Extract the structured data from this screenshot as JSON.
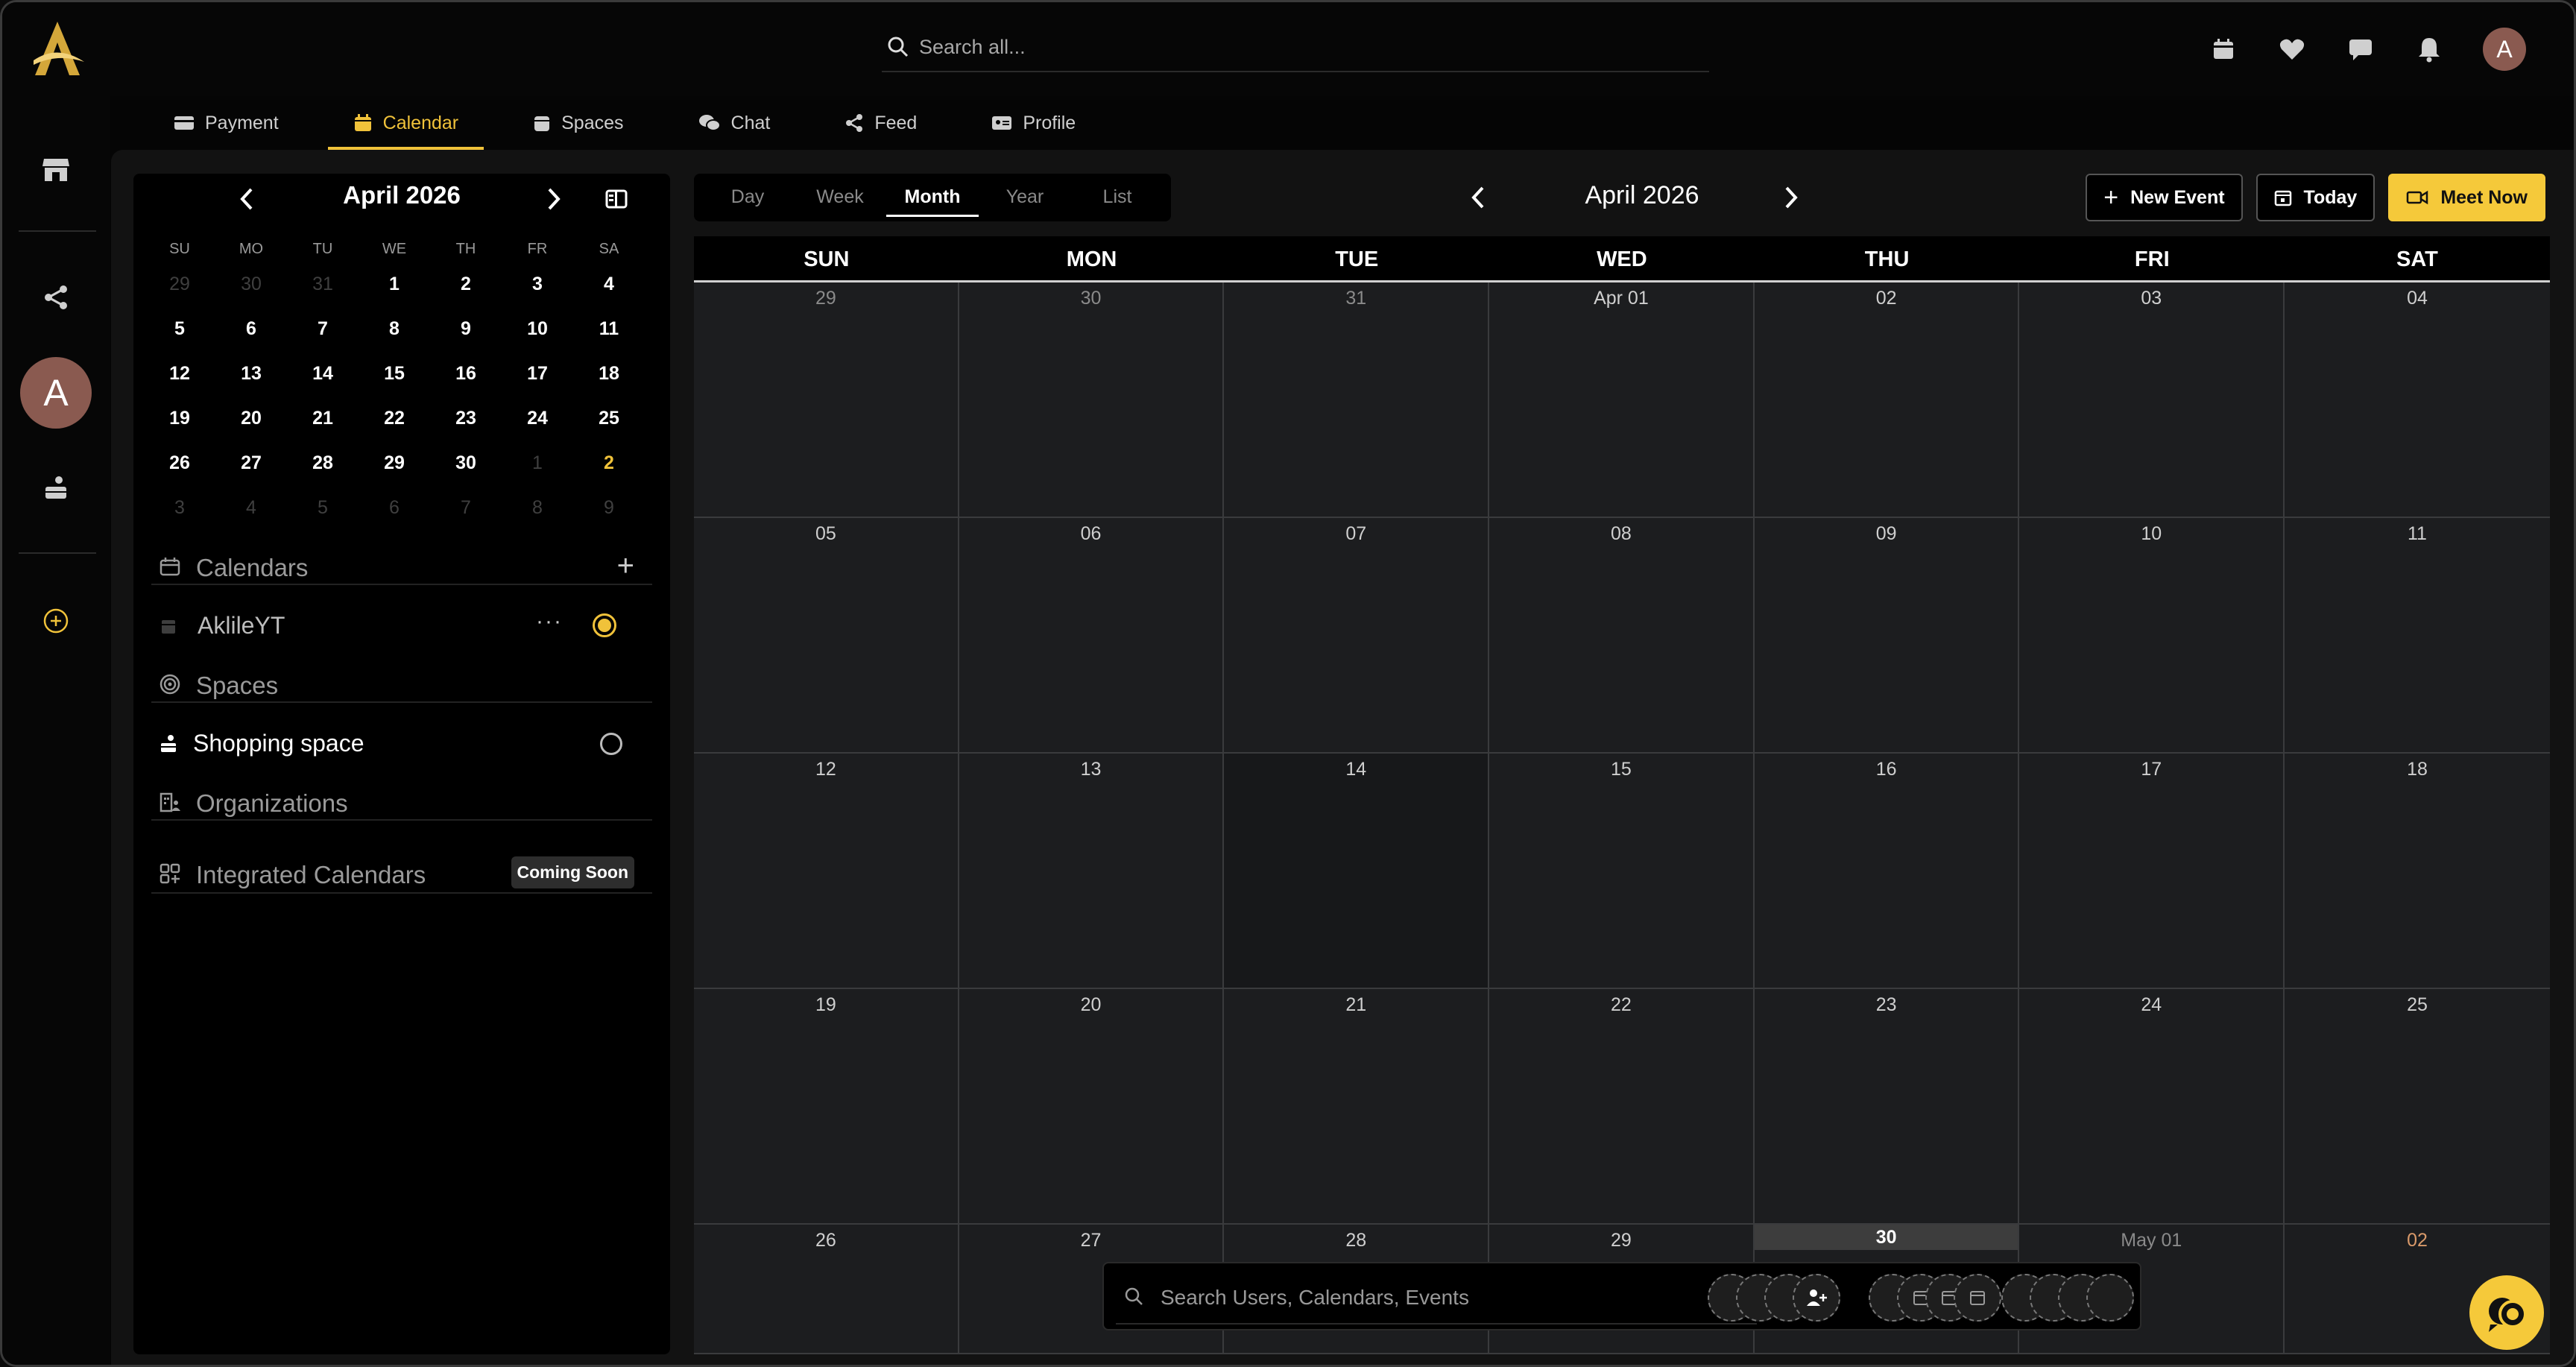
{
  "search": {
    "placeholder": "Search all..."
  },
  "top_icons": [
    "calendar-icon",
    "heart-icon",
    "chat-bubble-icon",
    "bell-icon"
  ],
  "user_initial": "A",
  "nav_tabs": [
    {
      "label": "Payment",
      "icon": "card-icon",
      "active": false
    },
    {
      "label": "Calendar",
      "icon": "calendar-icon",
      "active": true
    },
    {
      "label": "Spaces",
      "icon": "box-icon",
      "active": false
    },
    {
      "label": "Chat",
      "icon": "chat-icon",
      "active": false
    },
    {
      "label": "Feed",
      "icon": "share-icon",
      "active": false
    },
    {
      "label": "Profile",
      "icon": "id-card-icon",
      "active": false
    }
  ],
  "rail": {
    "avatar_initial": "A"
  },
  "mini_calendar": {
    "title": "April 2026",
    "weekdays": [
      "SU",
      "MO",
      "TU",
      "WE",
      "TH",
      "FR",
      "SA"
    ],
    "weeks": [
      [
        "29",
        "30",
        "31",
        "1",
        "2",
        "3",
        "4"
      ],
      [
        "5",
        "6",
        "7",
        "8",
        "9",
        "10",
        "11"
      ],
      [
        "12",
        "13",
        "14",
        "15",
        "16",
        "17",
        "18"
      ],
      [
        "19",
        "20",
        "21",
        "22",
        "23",
        "24",
        "25"
      ],
      [
        "26",
        "27",
        "28",
        "29",
        "30",
        "1",
        "2"
      ],
      [
        "3",
        "4",
        "5",
        "6",
        "7",
        "8",
        "9"
      ]
    ]
  },
  "sidebar": {
    "calendars_label": "Calendars",
    "calendar_item": "AklileYT",
    "calendar_item_menu": "···",
    "spaces_label": "Spaces",
    "space_item": "Shopping space",
    "organizations_label": "Organizations",
    "integrated_label": "Integrated Calendars",
    "coming_soon": "Coming Soon"
  },
  "views": [
    "Day",
    "Week",
    "Month",
    "Year",
    "List"
  ],
  "active_view": "Month",
  "calendar": {
    "title": "April 2026",
    "weekdays": [
      "SUN",
      "MON",
      "TUE",
      "WED",
      "THU",
      "FRI",
      "SAT"
    ],
    "weeks": [
      [
        "29",
        "30",
        "31",
        "Apr 01",
        "02",
        "03",
        "04"
      ],
      [
        "05",
        "06",
        "07",
        "08",
        "09",
        "10",
        "11"
      ],
      [
        "12",
        "13",
        "14",
        "15",
        "16",
        "17",
        "18"
      ],
      [
        "19",
        "20",
        "21",
        "22",
        "23",
        "24",
        "25"
      ],
      [
        "26",
        "27",
        "28",
        "29",
        "30",
        "May 01",
        "02"
      ]
    ],
    "today": "30"
  },
  "buttons": {
    "new_event": "New Event",
    "today": "Today",
    "meet_now": "Meet Now"
  },
  "bottom_search": {
    "placeholder": "Search Users, Calendars, Events"
  },
  "colors": {
    "accent": "#f5c93a",
    "background": "#050505",
    "cell": "#1c1d1f"
  }
}
